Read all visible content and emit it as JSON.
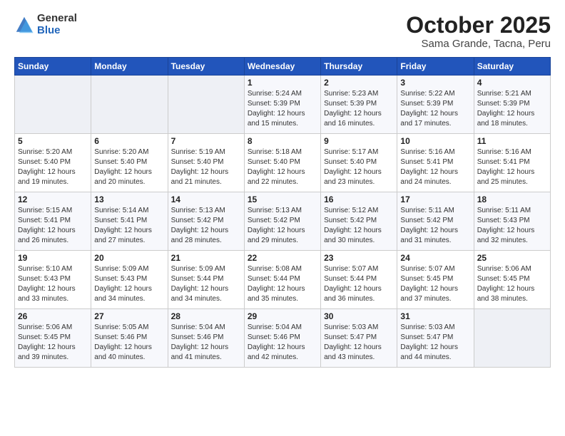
{
  "logo": {
    "general": "General",
    "blue": "Blue"
  },
  "title": "October 2025",
  "subtitle": "Sama Grande, Tacna, Peru",
  "header": {
    "days": [
      "Sunday",
      "Monday",
      "Tuesday",
      "Wednesday",
      "Thursday",
      "Friday",
      "Saturday"
    ]
  },
  "weeks": [
    [
      {
        "day": "",
        "info": ""
      },
      {
        "day": "",
        "info": ""
      },
      {
        "day": "",
        "info": ""
      },
      {
        "day": "1",
        "info": "Sunrise: 5:24 AM\nSunset: 5:39 PM\nDaylight: 12 hours\nand 15 minutes."
      },
      {
        "day": "2",
        "info": "Sunrise: 5:23 AM\nSunset: 5:39 PM\nDaylight: 12 hours\nand 16 minutes."
      },
      {
        "day": "3",
        "info": "Sunrise: 5:22 AM\nSunset: 5:39 PM\nDaylight: 12 hours\nand 17 minutes."
      },
      {
        "day": "4",
        "info": "Sunrise: 5:21 AM\nSunset: 5:39 PM\nDaylight: 12 hours\nand 18 minutes."
      }
    ],
    [
      {
        "day": "5",
        "info": "Sunrise: 5:20 AM\nSunset: 5:40 PM\nDaylight: 12 hours\nand 19 minutes."
      },
      {
        "day": "6",
        "info": "Sunrise: 5:20 AM\nSunset: 5:40 PM\nDaylight: 12 hours\nand 20 minutes."
      },
      {
        "day": "7",
        "info": "Sunrise: 5:19 AM\nSunset: 5:40 PM\nDaylight: 12 hours\nand 21 minutes."
      },
      {
        "day": "8",
        "info": "Sunrise: 5:18 AM\nSunset: 5:40 PM\nDaylight: 12 hours\nand 22 minutes."
      },
      {
        "day": "9",
        "info": "Sunrise: 5:17 AM\nSunset: 5:40 PM\nDaylight: 12 hours\nand 23 minutes."
      },
      {
        "day": "10",
        "info": "Sunrise: 5:16 AM\nSunset: 5:41 PM\nDaylight: 12 hours\nand 24 minutes."
      },
      {
        "day": "11",
        "info": "Sunrise: 5:16 AM\nSunset: 5:41 PM\nDaylight: 12 hours\nand 25 minutes."
      }
    ],
    [
      {
        "day": "12",
        "info": "Sunrise: 5:15 AM\nSunset: 5:41 PM\nDaylight: 12 hours\nand 26 minutes."
      },
      {
        "day": "13",
        "info": "Sunrise: 5:14 AM\nSunset: 5:41 PM\nDaylight: 12 hours\nand 27 minutes."
      },
      {
        "day": "14",
        "info": "Sunrise: 5:13 AM\nSunset: 5:42 PM\nDaylight: 12 hours\nand 28 minutes."
      },
      {
        "day": "15",
        "info": "Sunrise: 5:13 AM\nSunset: 5:42 PM\nDaylight: 12 hours\nand 29 minutes."
      },
      {
        "day": "16",
        "info": "Sunrise: 5:12 AM\nSunset: 5:42 PM\nDaylight: 12 hours\nand 30 minutes."
      },
      {
        "day": "17",
        "info": "Sunrise: 5:11 AM\nSunset: 5:42 PM\nDaylight: 12 hours\nand 31 minutes."
      },
      {
        "day": "18",
        "info": "Sunrise: 5:11 AM\nSunset: 5:43 PM\nDaylight: 12 hours\nand 32 minutes."
      }
    ],
    [
      {
        "day": "19",
        "info": "Sunrise: 5:10 AM\nSunset: 5:43 PM\nDaylight: 12 hours\nand 33 minutes."
      },
      {
        "day": "20",
        "info": "Sunrise: 5:09 AM\nSunset: 5:43 PM\nDaylight: 12 hours\nand 34 minutes."
      },
      {
        "day": "21",
        "info": "Sunrise: 5:09 AM\nSunset: 5:44 PM\nDaylight: 12 hours\nand 34 minutes."
      },
      {
        "day": "22",
        "info": "Sunrise: 5:08 AM\nSunset: 5:44 PM\nDaylight: 12 hours\nand 35 minutes."
      },
      {
        "day": "23",
        "info": "Sunrise: 5:07 AM\nSunset: 5:44 PM\nDaylight: 12 hours\nand 36 minutes."
      },
      {
        "day": "24",
        "info": "Sunrise: 5:07 AM\nSunset: 5:45 PM\nDaylight: 12 hours\nand 37 minutes."
      },
      {
        "day": "25",
        "info": "Sunrise: 5:06 AM\nSunset: 5:45 PM\nDaylight: 12 hours\nand 38 minutes."
      }
    ],
    [
      {
        "day": "26",
        "info": "Sunrise: 5:06 AM\nSunset: 5:45 PM\nDaylight: 12 hours\nand 39 minutes."
      },
      {
        "day": "27",
        "info": "Sunrise: 5:05 AM\nSunset: 5:46 PM\nDaylight: 12 hours\nand 40 minutes."
      },
      {
        "day": "28",
        "info": "Sunrise: 5:04 AM\nSunset: 5:46 PM\nDaylight: 12 hours\nand 41 minutes."
      },
      {
        "day": "29",
        "info": "Sunrise: 5:04 AM\nSunset: 5:46 PM\nDaylight: 12 hours\nand 42 minutes."
      },
      {
        "day": "30",
        "info": "Sunrise: 5:03 AM\nSunset: 5:47 PM\nDaylight: 12 hours\nand 43 minutes."
      },
      {
        "day": "31",
        "info": "Sunrise: 5:03 AM\nSunset: 5:47 PM\nDaylight: 12 hours\nand 44 minutes."
      },
      {
        "day": "",
        "info": ""
      }
    ]
  ]
}
